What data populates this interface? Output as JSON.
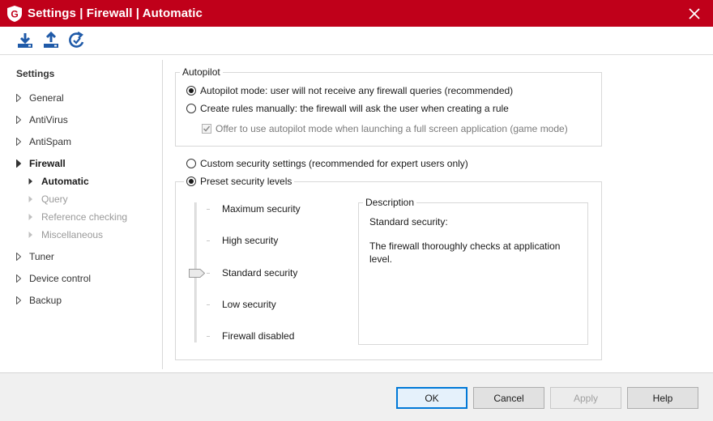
{
  "window": {
    "title": "Settings | Firewall | Automatic",
    "accent_color": "#c0001a"
  },
  "toolbar": {
    "buttons": [
      {
        "icon": "import-icon"
      },
      {
        "icon": "export-icon"
      },
      {
        "icon": "restore-icon"
      }
    ]
  },
  "sidebar": {
    "heading": "Settings",
    "items": [
      {
        "label": "General"
      },
      {
        "label": "AntiVirus"
      },
      {
        "label": "AntiSpam"
      },
      {
        "label": "Firewall",
        "expanded": true
      },
      {
        "label": "Automatic",
        "selected": true
      },
      {
        "label": "Query",
        "disabled": true
      },
      {
        "label": "Reference checking",
        "disabled": true
      },
      {
        "label": "Miscellaneous",
        "disabled": true
      },
      {
        "label": "Tuner"
      },
      {
        "label": "Device control"
      },
      {
        "label": "Backup"
      }
    ]
  },
  "autopilot": {
    "legend": "Autopilot",
    "option_autopilot": "Autopilot mode: user will not receive any firewall queries (recommended)",
    "option_manual": "Create rules manually: the firewall will ask the user when creating a rule",
    "game_mode_checkbox": "Offer to use autopilot mode when launching a full screen application (game mode)"
  },
  "security": {
    "option_custom": "Custom security settings (recommended for expert users only)",
    "option_preset": "Preset security levels",
    "levels": [
      "Maximum security",
      "High security",
      "Standard security",
      "Low security",
      "Firewall disabled"
    ],
    "selected_level": "Standard security"
  },
  "description": {
    "legend": "Description",
    "title": "Standard security:",
    "body": "The firewall thoroughly checks at application level."
  },
  "footer": {
    "ok": "OK",
    "cancel": "Cancel",
    "apply": "Apply",
    "help": "Help"
  }
}
